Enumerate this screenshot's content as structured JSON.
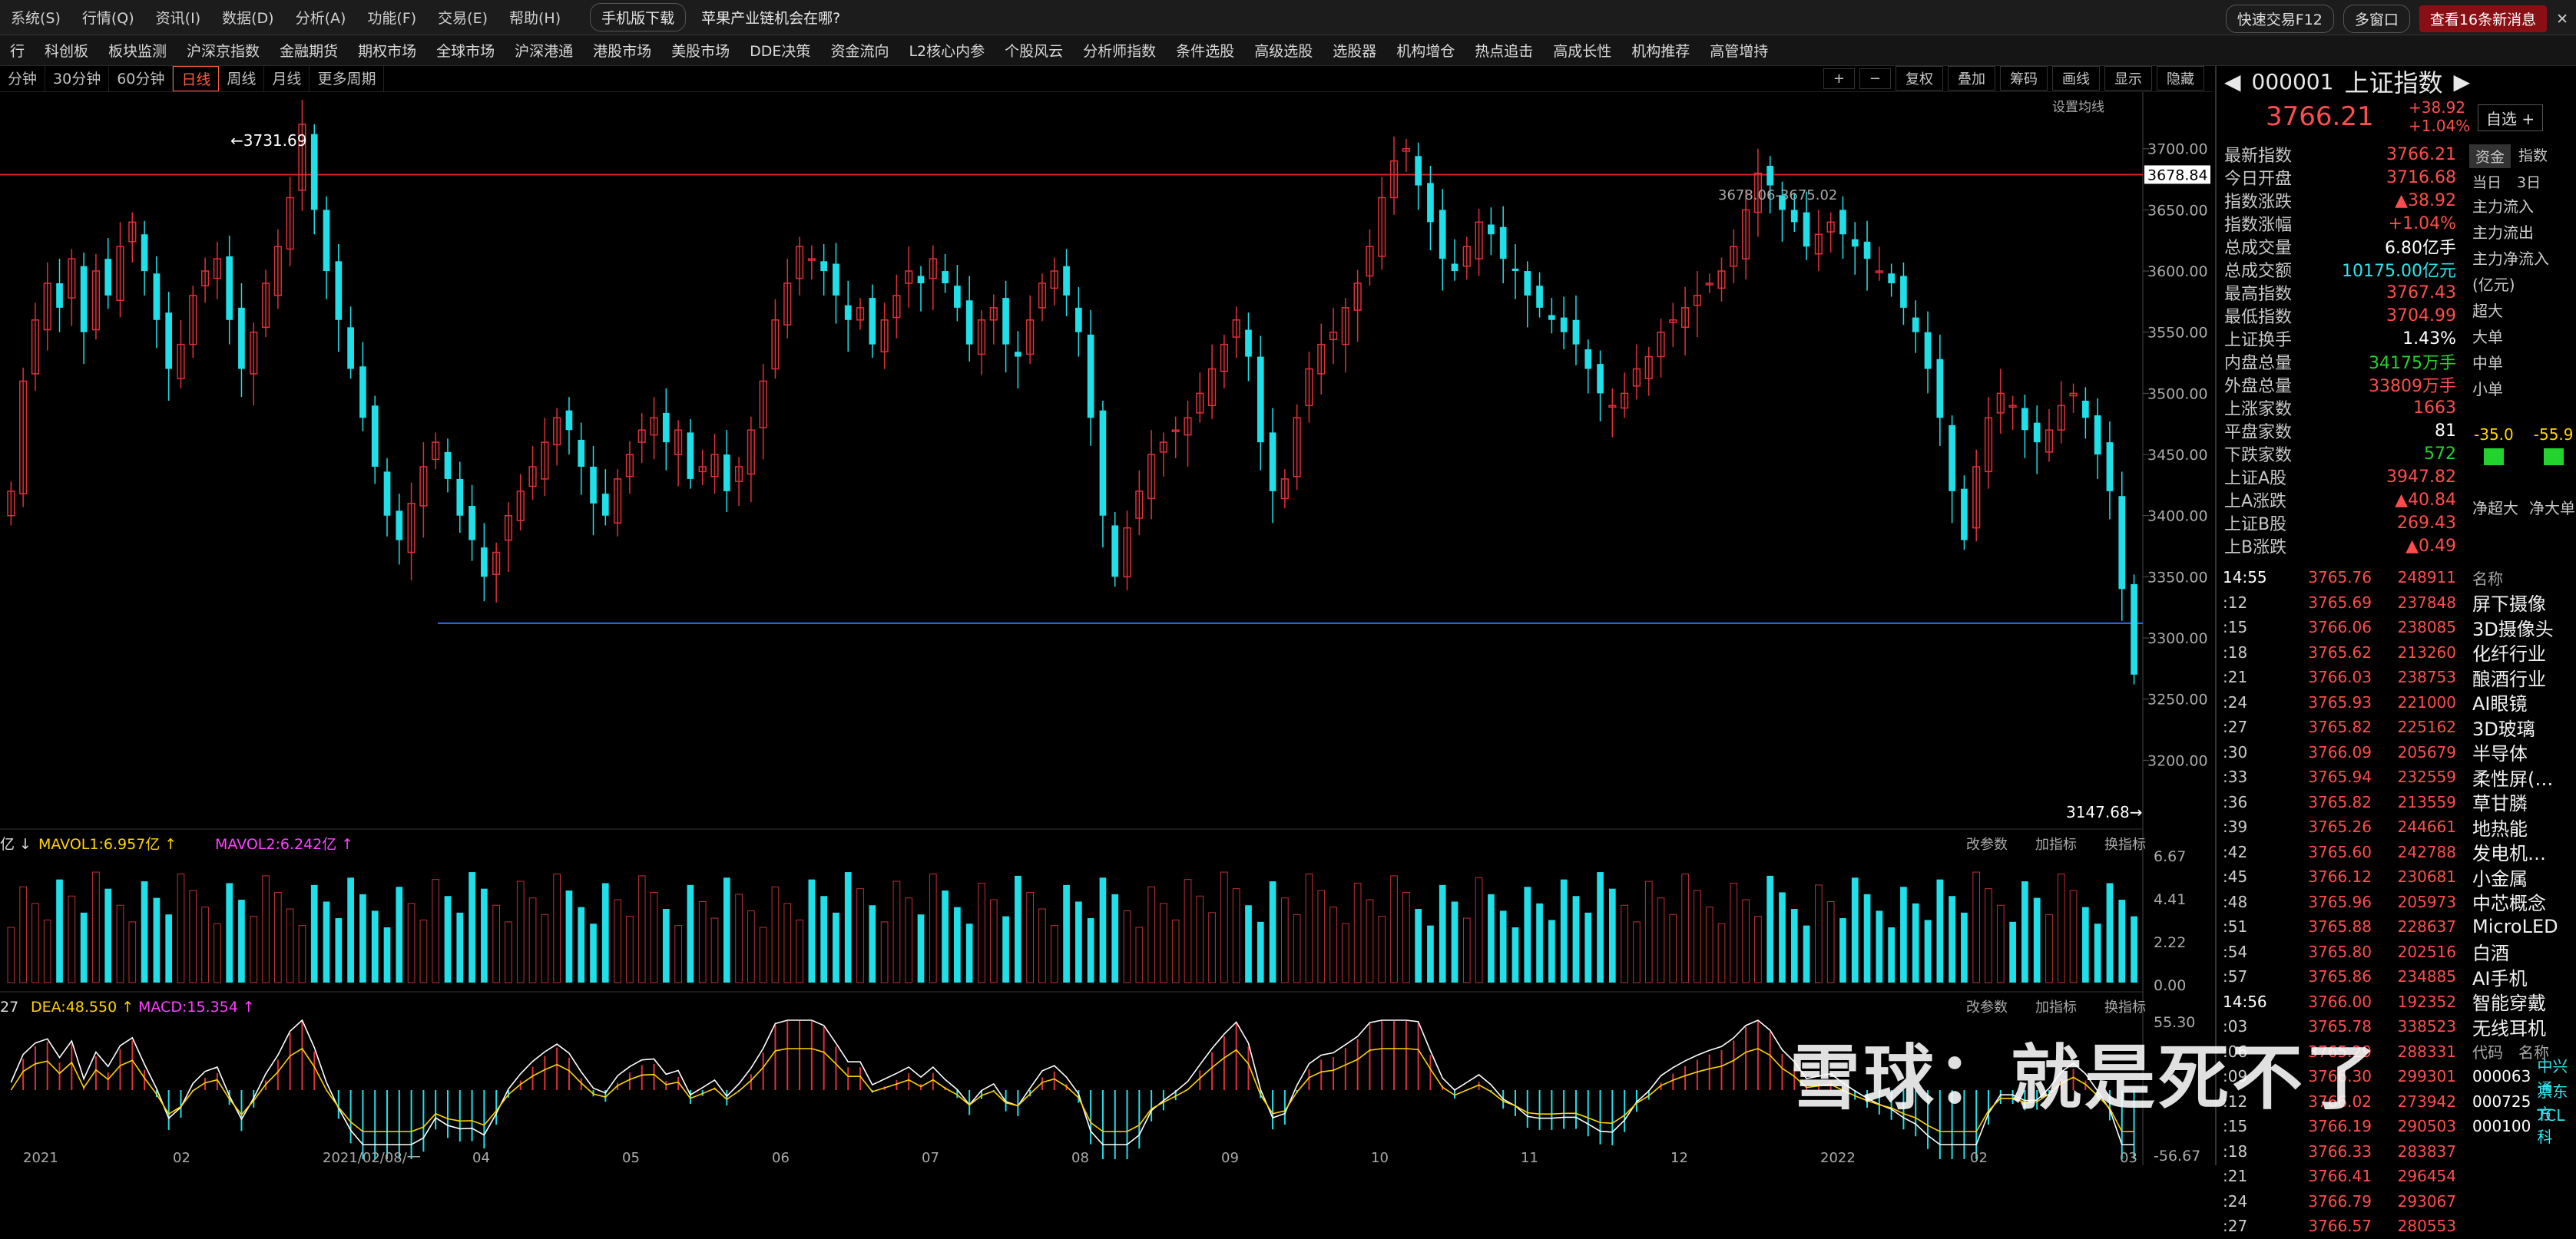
{
  "menubar": {
    "items": [
      "系统(S)",
      "行情(Q)",
      "资讯(I)",
      "数据(D)",
      "分析(A)",
      "功能(F)",
      "交易(E)",
      "帮助(H)"
    ],
    "mobile_download": "手机版下载",
    "ad_text": "苹果产业链机会在哪?",
    "fast_trade": "快速交易F12",
    "multi_window": "多窗口",
    "new_messages": "查看16条新消息",
    "badge": "16"
  },
  "navbar": {
    "items": [
      "行",
      "科创板",
      "板块监测",
      "沪深京指数",
      "金融期货",
      "期权市场",
      "全球市场",
      "沪深港通",
      "港股市场",
      "美股市场",
      "DDE决策",
      "资金流向",
      "L2核心内参",
      "个股风云",
      "分析师指数",
      "条件选股",
      "高级选股",
      "选股器",
      "机构增仓",
      "热点追击",
      "高成长性",
      "机构推荐",
      "高管增持"
    ]
  },
  "periodbar": {
    "items": [
      "分钟",
      "30分钟",
      "60分钟",
      "日线",
      "周线",
      "月线",
      "更多周期"
    ],
    "active": "日线",
    "tools": [
      "+",
      "−",
      "复权",
      "叠加",
      "筹码",
      "画线",
      "显示",
      "隐藏"
    ]
  },
  "chart_data": {
    "type": "candlestick",
    "title": "上证指数 日线",
    "annotations": {
      "high_label": "3731.69",
      "low_label": "3147.68",
      "prev_close_label": "3678.84",
      "range_label": "3678.06-3675.02",
      "settings_label": "设置均线"
    },
    "ylim": [
      3145,
      3740
    ],
    "y_ticks": [
      "3700.00",
      "3650.00",
      "3600.00",
      "3550.00",
      "3500.00",
      "3450.00",
      "3400.00",
      "3350.00",
      "3300.00",
      "3250.00",
      "3200.00"
    ],
    "x_ticks": [
      "2021",
      "02",
      "2021/02/08/一",
      "04",
      "05",
      "06",
      "07",
      "08",
      "09",
      "10",
      "11",
      "12",
      "2022",
      "02",
      "03"
    ],
    "red_line_value": 3678.84,
    "blue_line_value": 3312,
    "close": [
      3420,
      3510,
      3560,
      3590,
      3570,
      3610,
      3550,
      3600,
      3580,
      3620,
      3640,
      3600,
      3560,
      3520,
      3540,
      3580,
      3600,
      3610,
      3560,
      3520,
      3550,
      3590,
      3620,
      3660,
      3720,
      3650,
      3600,
      3560,
      3520,
      3480,
      3440,
      3400,
      3380,
      3410,
      3440,
      3460,
      3430,
      3400,
      3380,
      3350,
      3370,
      3400,
      3420,
      3440,
      3460,
      3480,
      3470,
      3440,
      3410,
      3400,
      3430,
      3450,
      3470,
      3480,
      3460,
      3470,
      3430,
      3440,
      3450,
      3420,
      3440,
      3470,
      3510,
      3560,
      3590,
      3620,
      3610,
      3600,
      3580,
      3560,
      3570,
      3540,
      3560,
      3580,
      3600,
      3590,
      3610,
      3590,
      3570,
      3540,
      3560,
      3570,
      3540,
      3530,
      3560,
      3590,
      3600,
      3580,
      3550,
      3480,
      3400,
      3350,
      3390,
      3420,
      3450,
      3460,
      3470,
      3480,
      3500,
      3520,
      3540,
      3560,
      3530,
      3460,
      3420,
      3430,
      3480,
      3520,
      3540,
      3550,
      3570,
      3590,
      3620,
      3660,
      3690,
      3700,
      3670,
      3640,
      3610,
      3600,
      3620,
      3640,
      3630,
      3610,
      3600,
      3580,
      3570,
      3560,
      3550,
      3540,
      3520,
      3500,
      3490,
      3500,
      3520,
      3530,
      3550,
      3560,
      3570,
      3580,
      3590,
      3600,
      3620,
      3650,
      3680,
      3670,
      3650,
      3640,
      3620,
      3630,
      3640,
      3630,
      3620,
      3610,
      3600,
      3590,
      3570,
      3550,
      3520,
      3480,
      3420,
      3380,
      3440,
      3480,
      3500,
      3490,
      3470,
      3460,
      3470,
      3490,
      3500,
      3480,
      3450,
      3420,
      3340,
      3270
    ],
    "volume_axis": [
      "6.67",
      "4.41",
      "2.22",
      "0.00"
    ],
    "volume_label": {
      "main": "亿",
      "mavol1": "MAVOL1:6.957亿",
      "mavol2": "MAVOL2:6.242亿"
    },
    "macd_axis": [
      "55.30",
      "-56.67"
    ],
    "macd_label": {
      "dif": "27",
      "dea": "DEA:48.550",
      "macd": "MACD:15.354"
    },
    "indicator_buttons": [
      "改参数",
      "加指标",
      "换指标"
    ]
  },
  "quote": {
    "code": "000001",
    "name": "上证指数",
    "price": "3766.21",
    "change": "+38.92",
    "change_pct": "+1.04%",
    "add_watch": "自选 +",
    "stats": [
      {
        "label": "最新指数",
        "value": "3766.21",
        "cls": "red"
      },
      {
        "label": "今日开盘",
        "value": "3716.68",
        "cls": "red"
      },
      {
        "label": "指数涨跌",
        "value": "▲38.92",
        "cls": "red"
      },
      {
        "label": "指数涨幅",
        "value": "+1.04%",
        "cls": "red"
      },
      {
        "label": "总成交量",
        "value": "6.80亿手",
        "cls": "wht"
      },
      {
        "label": "总成交额",
        "value": "10175.00亿元",
        "cls": "cyn"
      },
      {
        "label": "最高指数",
        "value": "3767.43",
        "cls": "red"
      },
      {
        "label": "最低指数",
        "value": "3704.99",
        "cls": "red"
      },
      {
        "label": "上证换手",
        "value": "1.43%",
        "cls": "wht"
      },
      {
        "label": "内盘总量",
        "value": "34175万手",
        "cls": "grn"
      },
      {
        "label": "外盘总量",
        "value": "33809万手",
        "cls": "red"
      },
      {
        "label": "上涨家数",
        "value": "1663",
        "cls": "red"
      },
      {
        "label": "平盘家数",
        "value": "81",
        "cls": "wht"
      },
      {
        "label": "下跌家数",
        "value": "572",
        "cls": "grn"
      },
      {
        "label": "上证A股",
        "value": "3947.82",
        "cls": "red"
      },
      {
        "label": "上A涨跌",
        "value": "▲40.84",
        "cls": "red"
      },
      {
        "label": "上证B股",
        "value": "269.43",
        "cls": "red"
      },
      {
        "label": "上B涨跌",
        "value": "▲0.49",
        "cls": "red"
      }
    ],
    "fund_tabs": [
      "资金",
      "指数"
    ],
    "fund_subtabs": [
      "当日",
      "3日"
    ],
    "fund_items": [
      "主力流入",
      "主力流出",
      "主力净流入",
      "(亿元)",
      "超大",
      "大单",
      "中单",
      "小单"
    ],
    "fund_bars": [
      "-35.0",
      "-55.9"
    ],
    "fund_footer": [
      "净超大",
      "净大单"
    ],
    "concept_header": "名称",
    "ticks_time_main": "14:55",
    "ticks": [
      {
        "t": "14:55",
        "p": "3765.76",
        "v": "248911"
      },
      {
        "t": ":12",
        "p": "3765.69",
        "v": "237848"
      },
      {
        "t": ":15",
        "p": "3766.06",
        "v": "238085"
      },
      {
        "t": ":18",
        "p": "3765.62",
        "v": "213260"
      },
      {
        "t": ":21",
        "p": "3766.03",
        "v": "238753"
      },
      {
        "t": ":24",
        "p": "3765.93",
        "v": "221000"
      },
      {
        "t": ":27",
        "p": "3765.82",
        "v": "225162"
      },
      {
        "t": ":30",
        "p": "3766.09",
        "v": "205679"
      },
      {
        "t": ":33",
        "p": "3765.94",
        "v": "232559"
      },
      {
        "t": ":36",
        "p": "3765.82",
        "v": "213559"
      },
      {
        "t": ":39",
        "p": "3765.26",
        "v": "244661"
      },
      {
        "t": ":42",
        "p": "3765.60",
        "v": "242788"
      },
      {
        "t": ":45",
        "p": "3766.12",
        "v": "230681"
      },
      {
        "t": ":48",
        "p": "3765.96",
        "v": "205973"
      },
      {
        "t": ":51",
        "p": "3765.88",
        "v": "228637"
      },
      {
        "t": ":54",
        "p": "3765.80",
        "v": "202516"
      },
      {
        "t": ":57",
        "p": "3765.86",
        "v": "234885"
      },
      {
        "t": "14:56",
        "p": "3766.00",
        "v": "192352"
      },
      {
        "t": ":03",
        "p": "3765.78",
        "v": "338523"
      },
      {
        "t": ":06",
        "p": "3765.29",
        "v": "288331"
      },
      {
        "t": ":09",
        "p": "3766.30",
        "v": "299301"
      },
      {
        "t": ":12",
        "p": "3766.02",
        "v": "273942"
      },
      {
        "t": ":15",
        "p": "3766.19",
        "v": "290503"
      },
      {
        "t": ":18",
        "p": "3766.33",
        "v": "283837"
      },
      {
        "t": ":21",
        "p": "3766.41",
        "v": "296454"
      },
      {
        "t": ":24",
        "p": "3766.79",
        "v": "293067"
      },
      {
        "t": ":27",
        "p": "3766.57",
        "v": "280553"
      }
    ],
    "concepts": [
      "屏下摄像",
      "3D摄像头",
      "化纤行业",
      "酿酒行业",
      "AI眼镜",
      "3D玻璃",
      "半导体",
      "柔性屏(…",
      "草甘膦",
      "地热能",
      "发电机…",
      "小金属",
      "中芯概念",
      "MicroLED",
      "白酒",
      "AI手机",
      "智能穿戴",
      "无线耳机"
    ],
    "stock_list_header": [
      "代码",
      "名称"
    ],
    "stock_list": [
      {
        "code": "000063",
        "name": "中兴通"
      },
      {
        "code": "000725",
        "name": "京东方"
      },
      {
        "code": "000100",
        "name": "TCL科"
      }
    ]
  },
  "watermark": "雪球：就是死不了"
}
